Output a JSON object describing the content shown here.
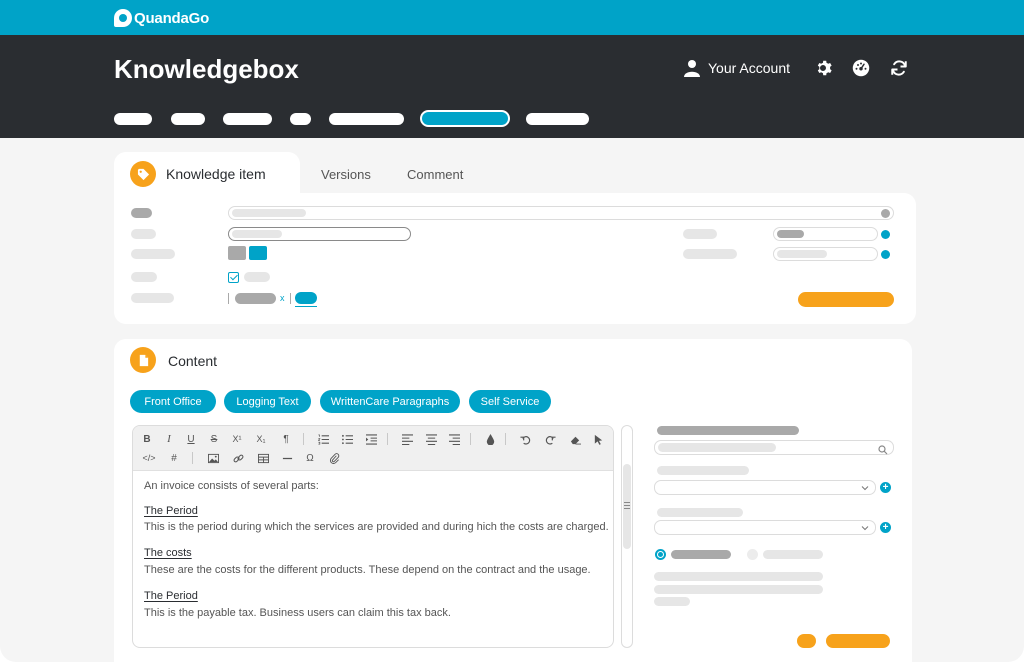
{
  "brand": {
    "name": "QuandaGo"
  },
  "header": {
    "title": "Knowledgebox",
    "account_label": "Your Account",
    "icons": [
      "user-icon",
      "gear-icon",
      "dashboard-icon",
      "refresh-icon"
    ]
  },
  "tabs": [
    {
      "label": "Knowledge item",
      "active": true
    },
    {
      "label": "Versions",
      "active": false
    },
    {
      "label": "Comment",
      "active": false
    }
  ],
  "content": {
    "title": "Content",
    "chips": [
      "Front Office",
      "Logging Text",
      "WrittenCare Paragraphs",
      "Self Service"
    ],
    "editor": {
      "intro": "An invoice consists of several parts:",
      "sections": [
        {
          "heading": "The Period",
          "body": "This is the period during which the services are provided and during hich the costs are charged."
        },
        {
          "heading": "The costs",
          "body": "These are the costs for the different products. These depend on the contract and the usage."
        },
        {
          "heading": "The Period",
          "body": "This is the payable tax. Business users can claim this tax back."
        }
      ],
      "toolbar": {
        "bold": "B",
        "italic": "I",
        "underline": "U",
        "strike": "S",
        "superscript": "X¹",
        "subscript": "X₁",
        "pilcrow": "¶",
        "code": "</>",
        "anchor": "#",
        "omega": "Ω"
      }
    },
    "plus_label": "+"
  },
  "colors": {
    "brand_blue": "#00a3c8",
    "header_dark": "#2a2d31",
    "accent_orange": "#f7a21b",
    "placeholder_grey": "#e6e6e6",
    "placeholder_dark": "#a9a9a9"
  }
}
